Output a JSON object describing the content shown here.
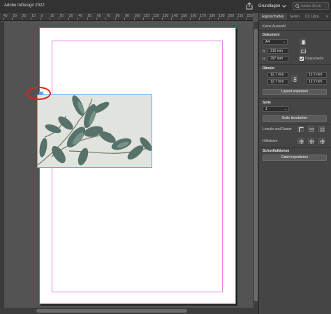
{
  "titlebar": {
    "title": "Adobe InDesign 2022",
    "workspace": "Grundlagen",
    "search_placeholder": "Adobe Stock"
  },
  "ruler": {
    "labels": [
      "40",
      "30",
      "20",
      "10",
      "0",
      "10",
      "20",
      "30",
      "40",
      "50",
      "60",
      "70",
      "80",
      "90",
      "100",
      "110",
      "120",
      "130",
      "140",
      "150",
      "160",
      "170",
      "180",
      "190",
      "200",
      "210",
      "220"
    ]
  },
  "panel": {
    "tabs": [
      "Eigenschaften",
      "Seiten",
      "CC Libra"
    ],
    "selection": "Keine Auswahl",
    "document": {
      "heading": "Dokument",
      "format": "A4",
      "width": "210 mm",
      "height": "297 mm",
      "width_label": "B",
      "height_label": "H",
      "facing_label": "Doppelseite",
      "facing_checked": true
    },
    "margins": {
      "heading": "Ränder",
      "top": "12,7 mm",
      "bottom": "12,7 mm",
      "left": "12,7 mm",
      "right": "12,7 mm",
      "adjust_button": "Layout anpassen"
    },
    "page": {
      "heading": "Seite",
      "value": "1",
      "edit_button": "Seite bearbeiten"
    },
    "rulers_grids": {
      "label": "Lineale und Raster"
    },
    "guides": {
      "label": "Hilfslinien"
    },
    "quick_actions": {
      "heading": "Schnellaktionen",
      "import_button": "Datei importieren"
    }
  },
  "colors": {
    "page_border": "#c44a76",
    "margin_guide": "#e27fe0",
    "frame_selection": "#6aa7e8",
    "highlight_circle": "#e02020"
  }
}
